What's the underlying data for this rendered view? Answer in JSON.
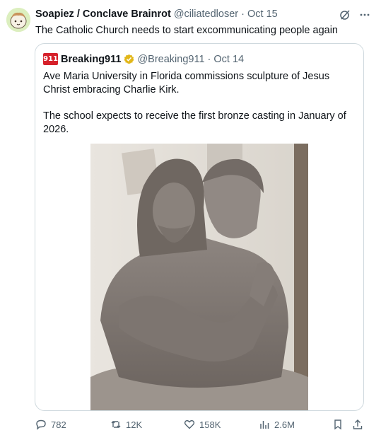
{
  "tweet": {
    "author_name": "Soapiez / Conclave Brainrot",
    "author_handle": "@ciliatedloser",
    "separator": "·",
    "date": "Oct 15",
    "text": "The Catholic Church needs to start excommunicating people again",
    "grok_icon": "grok-icon",
    "more_icon": "more-icon"
  },
  "quote": {
    "logo_text": "911",
    "author_name": "Breaking911",
    "verified_badge_color": "#e2b719",
    "author_handle": "@Breaking911",
    "separator": "·",
    "date": "Oct 14",
    "paragraph1": "Ave Maria University in Florida commissions sculpture of Jesus Christ embracing Charlie Kirk.",
    "paragraph2": "The school expects to receive the first bronze casting in January of 2026.",
    "media_description_icon": "sculpture-image"
  },
  "actions": {
    "replies": "782",
    "reposts": "12K",
    "likes": "158K",
    "views": "2.6M",
    "bookmark_icon": "bookmark-icon",
    "share_icon": "share-icon"
  },
  "colors": {
    "text": "#0f1419",
    "muted": "#536471",
    "border": "#cfd9de",
    "logo_red": "#d6202a"
  }
}
